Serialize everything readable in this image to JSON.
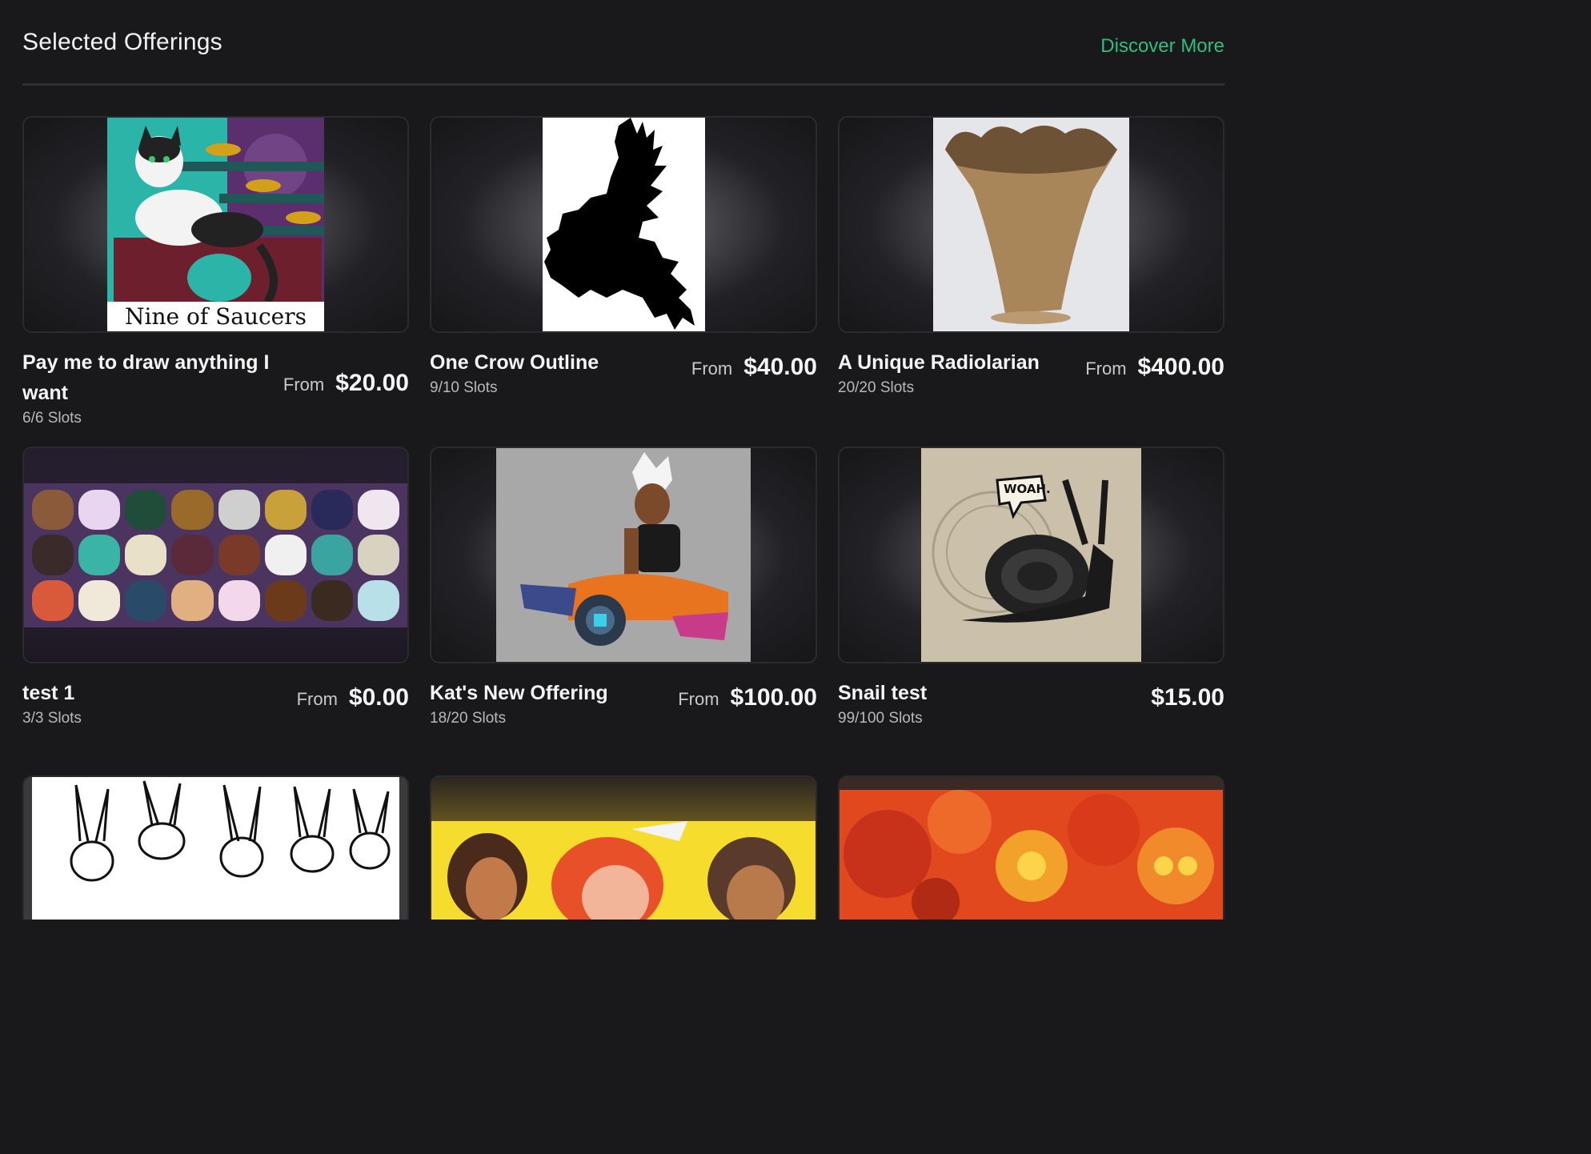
{
  "header": {
    "title": "Selected Offerings",
    "discover_label": "Discover More"
  },
  "colors": {
    "background": "#19191b",
    "accent": "#2fbf7f",
    "border": "#2b2b2e"
  },
  "offerings": [
    {
      "title": "Pay me to draw anything I want",
      "slots": "6/6 Slots",
      "from": "From",
      "price": "$20.00",
      "image": "tuxedo-cat-tarot-card",
      "caption": "Nine of Saucers"
    },
    {
      "title": "One Crow Outline",
      "slots": "9/10 Slots",
      "from": "From",
      "price": "$40.00",
      "image": "crow-silhouette"
    },
    {
      "title": "A Unique Radiolarian",
      "slots": "20/20 Slots",
      "from": "From",
      "price": "$400.00",
      "image": "clay-vase"
    },
    {
      "title": "test 1",
      "slots": "3/3 Slots",
      "from": "From",
      "price": "$0.00",
      "image": "creature-sprite-sheet"
    },
    {
      "title": "Kat's New Offering",
      "slots": "18/20 Slots",
      "from": "From",
      "price": "$100.00",
      "image": "seated-character-illustration"
    },
    {
      "title": "Snail test",
      "slots": "99/100 Slots",
      "from": "",
      "price": "$15.00",
      "image": "snail-ink-drawing",
      "speech": "WOAH."
    },
    {
      "image": "rabbit-sketch-sheet"
    },
    {
      "image": "cartoon-characters-yellow"
    },
    {
      "image": "red-creatures-illustration"
    }
  ]
}
